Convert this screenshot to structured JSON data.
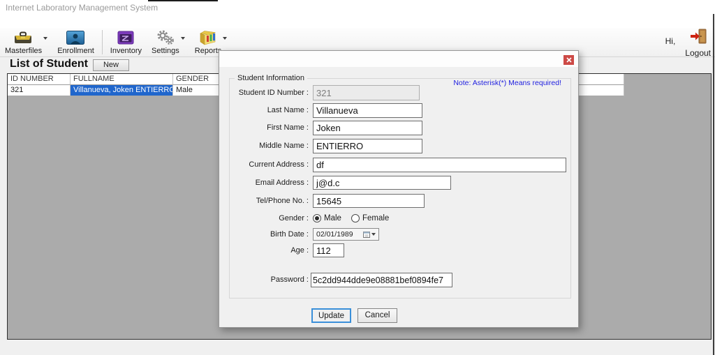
{
  "window": {
    "title": "Internet Laboratory Management System",
    "greeting": "Hi,",
    "logout_label": "Logout"
  },
  "toolbar": {
    "items": [
      {
        "label": "Masterfiles",
        "icon": "toolbox-icon",
        "has_dropdown": true
      },
      {
        "label": "Enrollment",
        "icon": "person-icon",
        "has_dropdown": false
      },
      {
        "label": "Inventory",
        "icon": "window-icon",
        "has_dropdown": false
      },
      {
        "label": "Settings",
        "icon": "gears-icon",
        "has_dropdown": true
      },
      {
        "label": "Reports",
        "icon": "chart-icon",
        "has_dropdown": true
      }
    ]
  },
  "student_list": {
    "title": "List of Student",
    "new_button_label": "New",
    "columns": {
      "id": "ID NUMBER",
      "fullname": "FULLNAME",
      "gender": "GENDER"
    },
    "rows": [
      {
        "id_number": "321",
        "fullname": "Villanueva, Joken ENTIERRO",
        "gender": "Male"
      }
    ],
    "selection_color": "#2066cc"
  },
  "dialog": {
    "group_title": "Student Information",
    "note": "Note: Asterisk(*) Means required!",
    "note_color": "#2121df",
    "fields": {
      "student_id": {
        "label": "Student ID Number :",
        "value": "321"
      },
      "last_name": {
        "label": "Last Name :",
        "value": "Villanueva"
      },
      "first_name": {
        "label": "First Name :",
        "value": "Joken"
      },
      "middle_name": {
        "label": "Middle Name :",
        "value": "ENTIERRO"
      },
      "current_address": {
        "label": "Current Address :",
        "value": "df"
      },
      "email": {
        "label": "Email Address :",
        "value": "j@d.c"
      },
      "phone": {
        "label": "Tel/Phone No. :",
        "value": "15645"
      },
      "gender": {
        "label": "Gender :",
        "options": [
          "Male",
          "Female"
        ],
        "selected": "Male"
      },
      "birth_date": {
        "label": "Birth Date :",
        "value": "02/01/1989"
      },
      "age": {
        "label": "Age :",
        "value": "112"
      },
      "password": {
        "label": "Password :",
        "value": "5c2dd944dde9e08881bef0894fe7"
      }
    },
    "buttons": {
      "update": "Update",
      "cancel": "Cancel"
    }
  }
}
